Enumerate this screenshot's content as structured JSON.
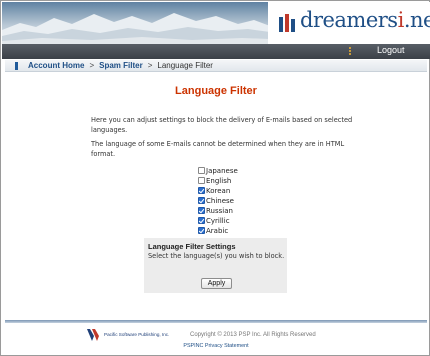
{
  "header": {
    "logo_text_pre": "dreamers",
    "logo_text_accent": "i",
    "logo_text_post": ".net",
    "logout_label": "Logout"
  },
  "breadcrumb": {
    "items": [
      {
        "label": "Account Home"
      },
      {
        "label": "Spam Filter"
      }
    ],
    "separator": ">",
    "current": "Language Filter"
  },
  "page": {
    "title": "Language Filter",
    "intro": "Here you can adjust settings to block the delivery of E-mails based on selected languages.",
    "note": "The language of some E-mails cannot be determined when they are in HTML format."
  },
  "languages": [
    {
      "label": "Japanese",
      "checked": false
    },
    {
      "label": "English",
      "checked": false
    },
    {
      "label": "Korean",
      "checked": true
    },
    {
      "label": "Chinese",
      "checked": true
    },
    {
      "label": "Russian",
      "checked": true
    },
    {
      "label": "Cyrillic",
      "checked": true
    },
    {
      "label": "Arabic",
      "checked": true
    }
  ],
  "settings_panel": {
    "title": "Language Filter Settings",
    "instruction": "Select the language(s) you wish to block.",
    "apply_label": "Apply"
  },
  "footer": {
    "company": "Pacific Software Publishing, Inc.",
    "copyright": "Copyright © 2013 PSP Inc. All Rights Reserved",
    "privacy_link": "PSPINC Privacy Statement"
  },
  "colors": {
    "title_red": "#cc3300",
    "link_blue": "#1f4f86",
    "checkbox_blue": "#2b6fce"
  }
}
